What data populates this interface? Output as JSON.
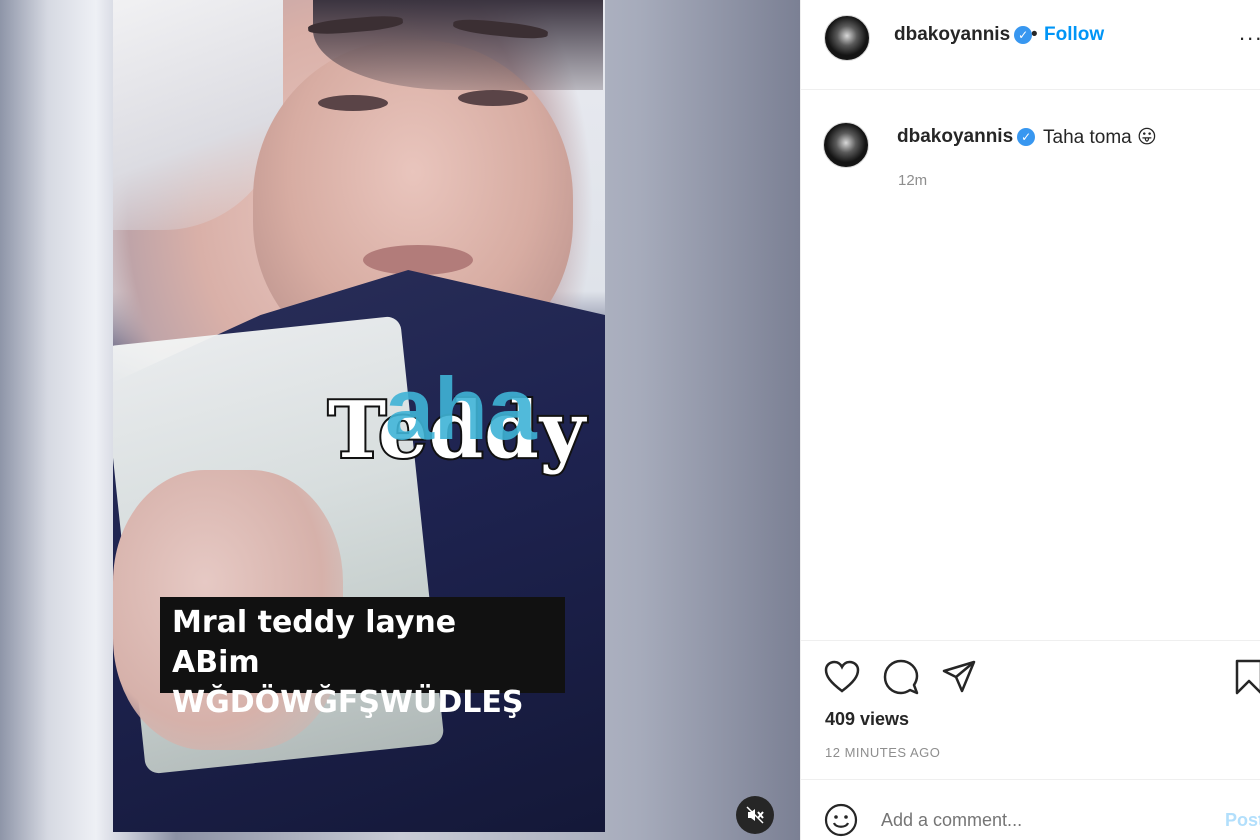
{
  "video": {
    "overlay_word_1": "Teddy",
    "overlay_word_2": "aha",
    "caption_line_1": "Mral teddy layne ABim",
    "caption_line_2": "WĞDÖWĞFŞWÜDLEŞ",
    "mute_icon": "speaker-muted-icon"
  },
  "header": {
    "username": "dbakoyannis",
    "separator": "•",
    "follow_label": "Follow",
    "more_label": "..."
  },
  "post": {
    "username": "dbakoyannis",
    "caption": "Taha toma",
    "emoji": "😛",
    "time_ago": "12m"
  },
  "actions": {
    "icons": [
      "heart-icon",
      "comment-icon",
      "share-icon",
      "bookmark-icon"
    ],
    "views": "409 views",
    "date": "12 MINUTES AGO"
  },
  "comment": {
    "placeholder": "Add a comment...",
    "post_label": "Post"
  },
  "colors": {
    "accent": "#0095f6",
    "verified": "#3897f0",
    "muted_text": "#8e8e8e"
  }
}
